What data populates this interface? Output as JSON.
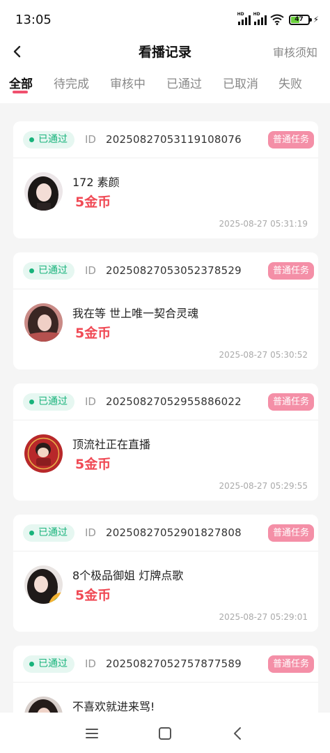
{
  "status_bar": {
    "time": "13:05",
    "battery": "47"
  },
  "header": {
    "title": "看播记录",
    "notice": "审核须知"
  },
  "tabs": [
    "全部",
    "待完成",
    "审核中",
    "已通过",
    "已取消",
    "失败"
  ],
  "records": [
    {
      "status": "已通过",
      "id_label": "ID",
      "id": "20250827053119108076",
      "task_type": "普通任务",
      "room": "172 素颜",
      "reward": "5金币",
      "time": "2025-08-27 05:31:19"
    },
    {
      "status": "已通过",
      "id_label": "ID",
      "id": "20250827053052378529",
      "task_type": "普通任务",
      "room": "我在等 世上唯一契合灵魂",
      "reward": "5金币",
      "time": "2025-08-27 05:30:52"
    },
    {
      "status": "已通过",
      "id_label": "ID",
      "id": "20250827052955886022",
      "task_type": "普通任务",
      "room": "顶流社正在直播",
      "reward": "5金币",
      "time": "2025-08-27 05:29:55"
    },
    {
      "status": "已通过",
      "id_label": "ID",
      "id": "20250827052901827808",
      "task_type": "普通任务",
      "room": "8个极品御姐 灯牌点歌",
      "reward": "5金币",
      "time": "2025-08-27 05:29:01"
    },
    {
      "status": "已通过",
      "id_label": "ID",
      "id": "20250827052757877589",
      "task_type": "普通任务",
      "room": "不喜欢就进来骂!",
      "reward": "",
      "time": ""
    }
  ],
  "colors": {
    "accent": "#f0506e",
    "approved": "#18b37b",
    "reward": "#f04a55",
    "task_badge": "#f48fa7"
  }
}
